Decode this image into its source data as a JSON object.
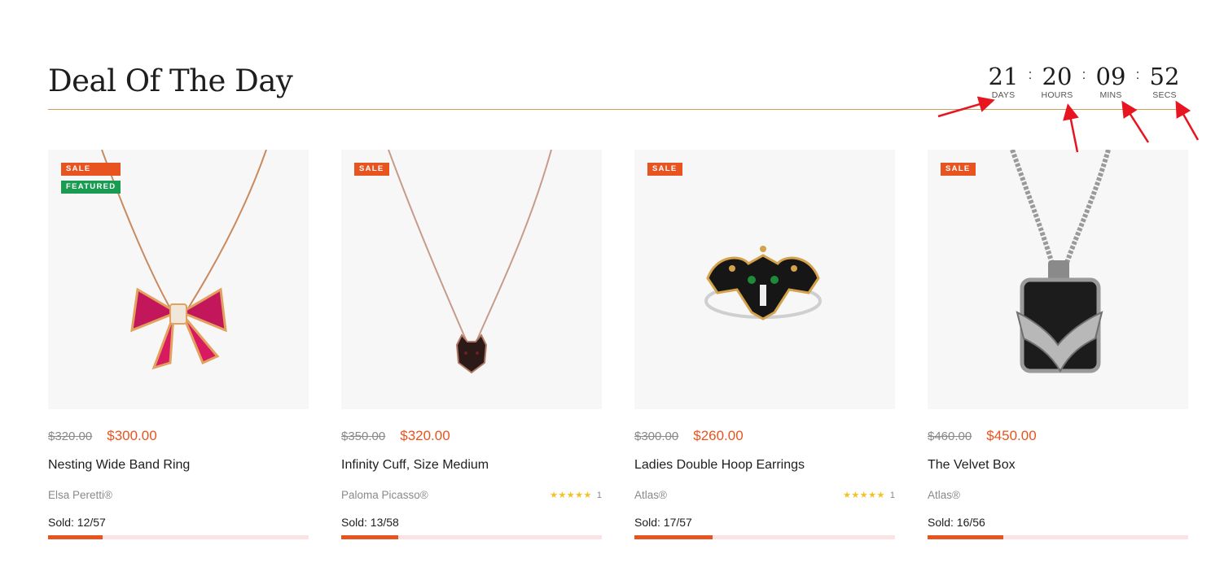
{
  "section": {
    "title": "Deal Of The Day"
  },
  "countdown": [
    {
      "value": "21",
      "label": "DAYS"
    },
    {
      "value": "20",
      "label": "HOURS"
    },
    {
      "value": "09",
      "label": "MINS"
    },
    {
      "value": "52",
      "label": "SECS"
    }
  ],
  "countdown_separator": ":",
  "colors": {
    "accent": "#e8541f",
    "featured": "#1a9b52",
    "divider": "#c9a15a",
    "star": "#f4c11f",
    "annotation_arrow": "#e8141f"
  },
  "products": [
    {
      "badges": [
        "SALE",
        "FEATURED"
      ],
      "image_icon": "bow-necklace-icon",
      "old_price": "$320.00",
      "new_price": "$300.00",
      "name": "Nesting Wide Band Ring",
      "brand": "Elsa Peretti®",
      "stars": "",
      "rating_count": "",
      "sold": "Sold: 12/57",
      "sold_fraction": 0.21
    },
    {
      "badges": [
        "SALE"
      ],
      "image_icon": "panther-pendant-necklace-icon",
      "old_price": "$350.00",
      "new_price": "$320.00",
      "name": "Infinity Cuff, Size Medium",
      "brand": "Paloma Picasso®",
      "stars": "★★★★★",
      "rating_count": "1",
      "sold": "Sold: 13/58",
      "sold_fraction": 0.22
    },
    {
      "badges": [
        "SALE"
      ],
      "image_icon": "panther-ring-icon",
      "old_price": "$300.00",
      "new_price": "$260.00",
      "name": "Ladies Double Hoop Earrings",
      "brand": "Atlas®",
      "stars": "★★★★★",
      "rating_count": "1",
      "sold": "Sold: 17/57",
      "sold_fraction": 0.3
    },
    {
      "badges": [
        "SALE"
      ],
      "image_icon": "eagle-pendant-necklace-icon",
      "old_price": "$460.00",
      "new_price": "$450.00",
      "name": "The Velvet Box",
      "brand": "Atlas®",
      "stars": "",
      "rating_count": "",
      "sold": "Sold: 16/56",
      "sold_fraction": 0.29
    }
  ]
}
